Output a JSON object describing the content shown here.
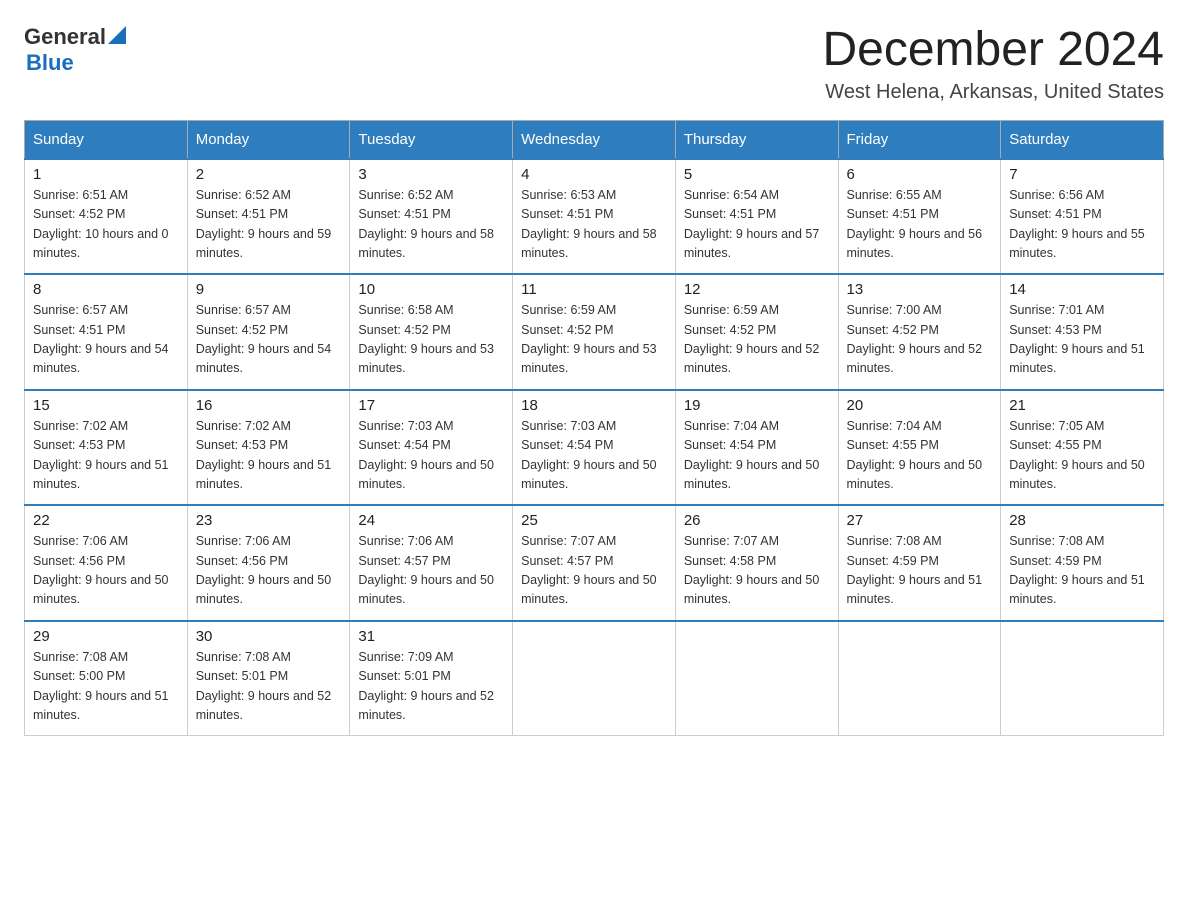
{
  "logo": {
    "text_general": "General",
    "text_blue": "Blue",
    "line2": "Blue"
  },
  "title": "December 2024",
  "subtitle": "West Helena, Arkansas, United States",
  "days_of_week": [
    "Sunday",
    "Monday",
    "Tuesday",
    "Wednesday",
    "Thursday",
    "Friday",
    "Saturday"
  ],
  "weeks": [
    [
      {
        "day": "1",
        "sunrise": "6:51 AM",
        "sunset": "4:52 PM",
        "daylight": "10 hours and 0 minutes."
      },
      {
        "day": "2",
        "sunrise": "6:52 AM",
        "sunset": "4:51 PM",
        "daylight": "9 hours and 59 minutes."
      },
      {
        "day": "3",
        "sunrise": "6:52 AM",
        "sunset": "4:51 PM",
        "daylight": "9 hours and 58 minutes."
      },
      {
        "day": "4",
        "sunrise": "6:53 AM",
        "sunset": "4:51 PM",
        "daylight": "9 hours and 58 minutes."
      },
      {
        "day": "5",
        "sunrise": "6:54 AM",
        "sunset": "4:51 PM",
        "daylight": "9 hours and 57 minutes."
      },
      {
        "day": "6",
        "sunrise": "6:55 AM",
        "sunset": "4:51 PM",
        "daylight": "9 hours and 56 minutes."
      },
      {
        "day": "7",
        "sunrise": "6:56 AM",
        "sunset": "4:51 PM",
        "daylight": "9 hours and 55 minutes."
      }
    ],
    [
      {
        "day": "8",
        "sunrise": "6:57 AM",
        "sunset": "4:51 PM",
        "daylight": "9 hours and 54 minutes."
      },
      {
        "day": "9",
        "sunrise": "6:57 AM",
        "sunset": "4:52 PM",
        "daylight": "9 hours and 54 minutes."
      },
      {
        "day": "10",
        "sunrise": "6:58 AM",
        "sunset": "4:52 PM",
        "daylight": "9 hours and 53 minutes."
      },
      {
        "day": "11",
        "sunrise": "6:59 AM",
        "sunset": "4:52 PM",
        "daylight": "9 hours and 53 minutes."
      },
      {
        "day": "12",
        "sunrise": "6:59 AM",
        "sunset": "4:52 PM",
        "daylight": "9 hours and 52 minutes."
      },
      {
        "day": "13",
        "sunrise": "7:00 AM",
        "sunset": "4:52 PM",
        "daylight": "9 hours and 52 minutes."
      },
      {
        "day": "14",
        "sunrise": "7:01 AM",
        "sunset": "4:53 PM",
        "daylight": "9 hours and 51 minutes."
      }
    ],
    [
      {
        "day": "15",
        "sunrise": "7:02 AM",
        "sunset": "4:53 PM",
        "daylight": "9 hours and 51 minutes."
      },
      {
        "day": "16",
        "sunrise": "7:02 AM",
        "sunset": "4:53 PM",
        "daylight": "9 hours and 51 minutes."
      },
      {
        "day": "17",
        "sunrise": "7:03 AM",
        "sunset": "4:54 PM",
        "daylight": "9 hours and 50 minutes."
      },
      {
        "day": "18",
        "sunrise": "7:03 AM",
        "sunset": "4:54 PM",
        "daylight": "9 hours and 50 minutes."
      },
      {
        "day": "19",
        "sunrise": "7:04 AM",
        "sunset": "4:54 PM",
        "daylight": "9 hours and 50 minutes."
      },
      {
        "day": "20",
        "sunrise": "7:04 AM",
        "sunset": "4:55 PM",
        "daylight": "9 hours and 50 minutes."
      },
      {
        "day": "21",
        "sunrise": "7:05 AM",
        "sunset": "4:55 PM",
        "daylight": "9 hours and 50 minutes."
      }
    ],
    [
      {
        "day": "22",
        "sunrise": "7:06 AM",
        "sunset": "4:56 PM",
        "daylight": "9 hours and 50 minutes."
      },
      {
        "day": "23",
        "sunrise": "7:06 AM",
        "sunset": "4:56 PM",
        "daylight": "9 hours and 50 minutes."
      },
      {
        "day": "24",
        "sunrise": "7:06 AM",
        "sunset": "4:57 PM",
        "daylight": "9 hours and 50 minutes."
      },
      {
        "day": "25",
        "sunrise": "7:07 AM",
        "sunset": "4:57 PM",
        "daylight": "9 hours and 50 minutes."
      },
      {
        "day": "26",
        "sunrise": "7:07 AM",
        "sunset": "4:58 PM",
        "daylight": "9 hours and 50 minutes."
      },
      {
        "day": "27",
        "sunrise": "7:08 AM",
        "sunset": "4:59 PM",
        "daylight": "9 hours and 51 minutes."
      },
      {
        "day": "28",
        "sunrise": "7:08 AM",
        "sunset": "4:59 PM",
        "daylight": "9 hours and 51 minutes."
      }
    ],
    [
      {
        "day": "29",
        "sunrise": "7:08 AM",
        "sunset": "5:00 PM",
        "daylight": "9 hours and 51 minutes."
      },
      {
        "day": "30",
        "sunrise": "7:08 AM",
        "sunset": "5:01 PM",
        "daylight": "9 hours and 52 minutes."
      },
      {
        "day": "31",
        "sunrise": "7:09 AM",
        "sunset": "5:01 PM",
        "daylight": "9 hours and 52 minutes."
      },
      null,
      null,
      null,
      null
    ]
  ]
}
